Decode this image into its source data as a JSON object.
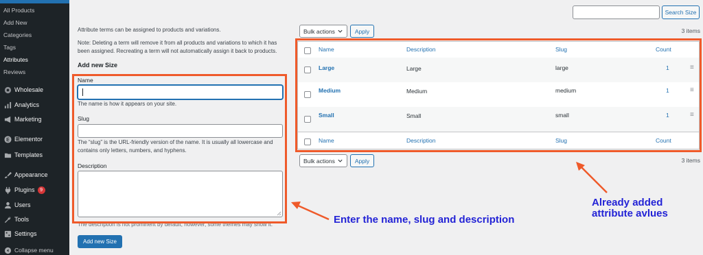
{
  "sidebar": {
    "submenu": [
      "All Products",
      "Add New",
      "Categories",
      "Tags",
      "Attributes",
      "Reviews"
    ],
    "menu": [
      {
        "label": "Wholesale",
        "icon": "wholesale-icon"
      },
      {
        "label": "Analytics",
        "icon": "analytics-icon"
      },
      {
        "label": "Marketing",
        "icon": "megaphone-icon"
      },
      {
        "label": "Elementor",
        "icon": "elementor-icon"
      },
      {
        "label": "Templates",
        "icon": "folder-icon"
      },
      {
        "label": "Appearance",
        "icon": "brush-icon"
      },
      {
        "label": "Plugins",
        "icon": "plug-icon",
        "badge": "9"
      },
      {
        "label": "Users",
        "icon": "user-icon"
      },
      {
        "label": "Tools",
        "icon": "wrench-icon"
      },
      {
        "label": "Settings",
        "icon": "settings-icon"
      },
      {
        "label": "Collapse menu",
        "icon": "collapse-icon"
      }
    ]
  },
  "form": {
    "intro": "Attribute terms can be assigned to products and variations.",
    "note_line1": "Note: Deleting a term will remove it from all products and variations to which it has",
    "note_line2": "been assigned. Recreating a term will not automatically assign it back to products.",
    "heading": "Add new Size",
    "name_label": "Name",
    "name_value": "",
    "name_help": "The name is how it appears on your site.",
    "slug_label": "Slug",
    "slug_value": "",
    "slug_help_line1": "The “slug” is the URL-friendly version of the name. It is usually all lowercase and",
    "slug_help_line2": "contains only letters, numbers, and hyphens.",
    "description_label": "Description",
    "description_value": "",
    "description_help": "The description is not prominent by default; however, some themes may show it.",
    "submit_label": "Add new Size"
  },
  "search": {
    "value": "",
    "button_label": "Search Size"
  },
  "bulk": {
    "select_label": "Bulk actions",
    "apply_label": "Apply",
    "items_count": "3 items"
  },
  "table": {
    "columns": [
      "Name",
      "Description",
      "Slug",
      "Count"
    ],
    "rows": [
      {
        "name": "Large",
        "description": "Large",
        "slug": "large",
        "count": "1"
      },
      {
        "name": "Medium",
        "description": "Medium",
        "slug": "medium",
        "count": "1"
      },
      {
        "name": "Small",
        "description": "Small",
        "slug": "small",
        "count": "1"
      }
    ]
  },
  "annotations": {
    "left_text": "Enter the name, slug and description",
    "right_line1": "Already added",
    "right_line2": "attribute avlues",
    "color": "#2323d6",
    "highlight_color": "#ef5a2a"
  }
}
